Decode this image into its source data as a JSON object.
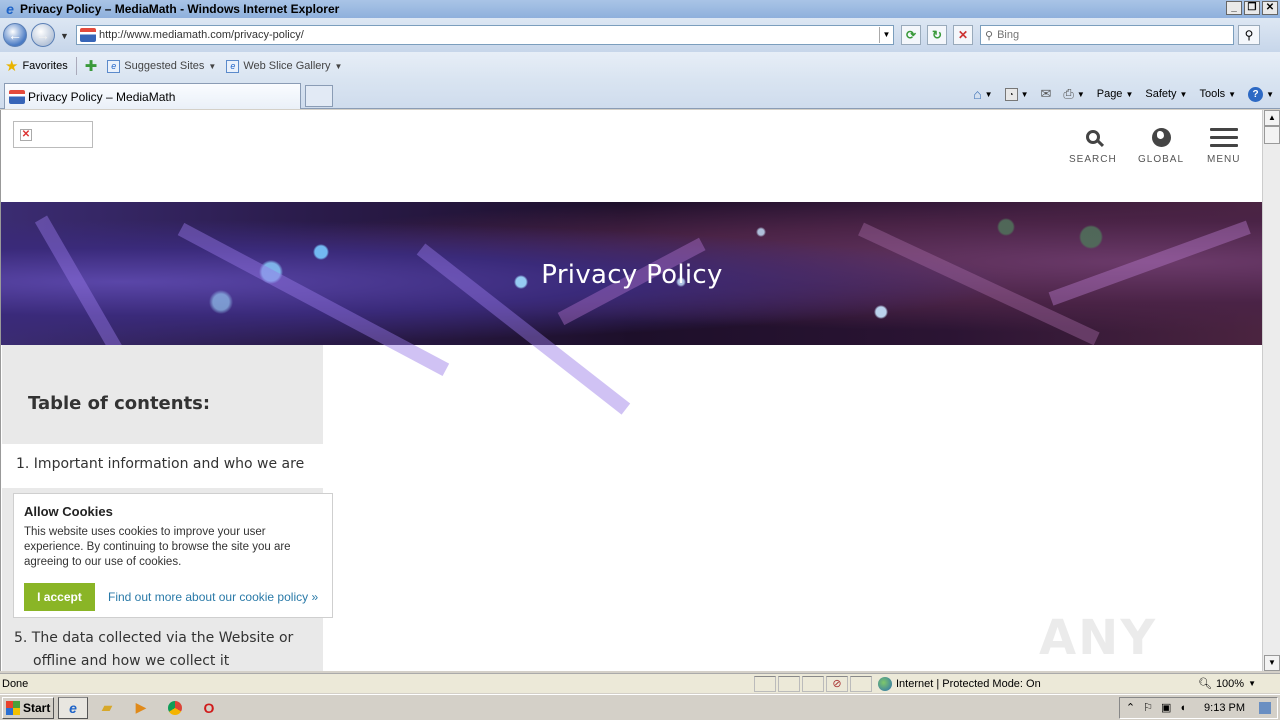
{
  "window": {
    "title": "Privacy Policy – MediaMath - Windows Internet Explorer",
    "controls": [
      "_",
      "❐",
      "✕"
    ]
  },
  "address": {
    "url": "http://www.mediamath.com/privacy-policy/",
    "search_placeholder": "Bing"
  },
  "favorites_bar": {
    "favorites_label": "Favorites",
    "items": [
      "Suggested Sites",
      "Web Slice Gallery"
    ]
  },
  "tabs": [
    {
      "label": "Privacy Policy – MediaMath"
    }
  ],
  "command_bar": {
    "page": "Page",
    "safety": "Safety",
    "tools": "Tools"
  },
  "site": {
    "nav": {
      "search": "SEARCH",
      "global": "GLOBAL",
      "menu": "MENU"
    },
    "banner_title": "Privacy Policy",
    "toc": {
      "title": "Table of contents:",
      "item_1": "1. Important information and who we are",
      "item_5_line1": "5. The data collected via the Website or",
      "item_5_line2": "offline and how we collect it"
    },
    "cookie": {
      "title": "Allow Cookies",
      "text": "This website uses cookies to improve your user experience. By continuing to browse the site you are agreeing to our use of cookies.",
      "accept": "I accept",
      "link": "Find out more about our cookie policy »"
    },
    "watermark": "ANY RUN"
  },
  "status_bar": {
    "text": "Done",
    "zone": "Internet | Protected Mode: On",
    "zoom": "100%"
  },
  "taskbar": {
    "start": "Start",
    "clock": "9:13 PM"
  },
  "colors": {
    "accept_button": "#8ab526",
    "cookie_link": "#2a7aa8",
    "toc_background": "#e9e9e9"
  }
}
